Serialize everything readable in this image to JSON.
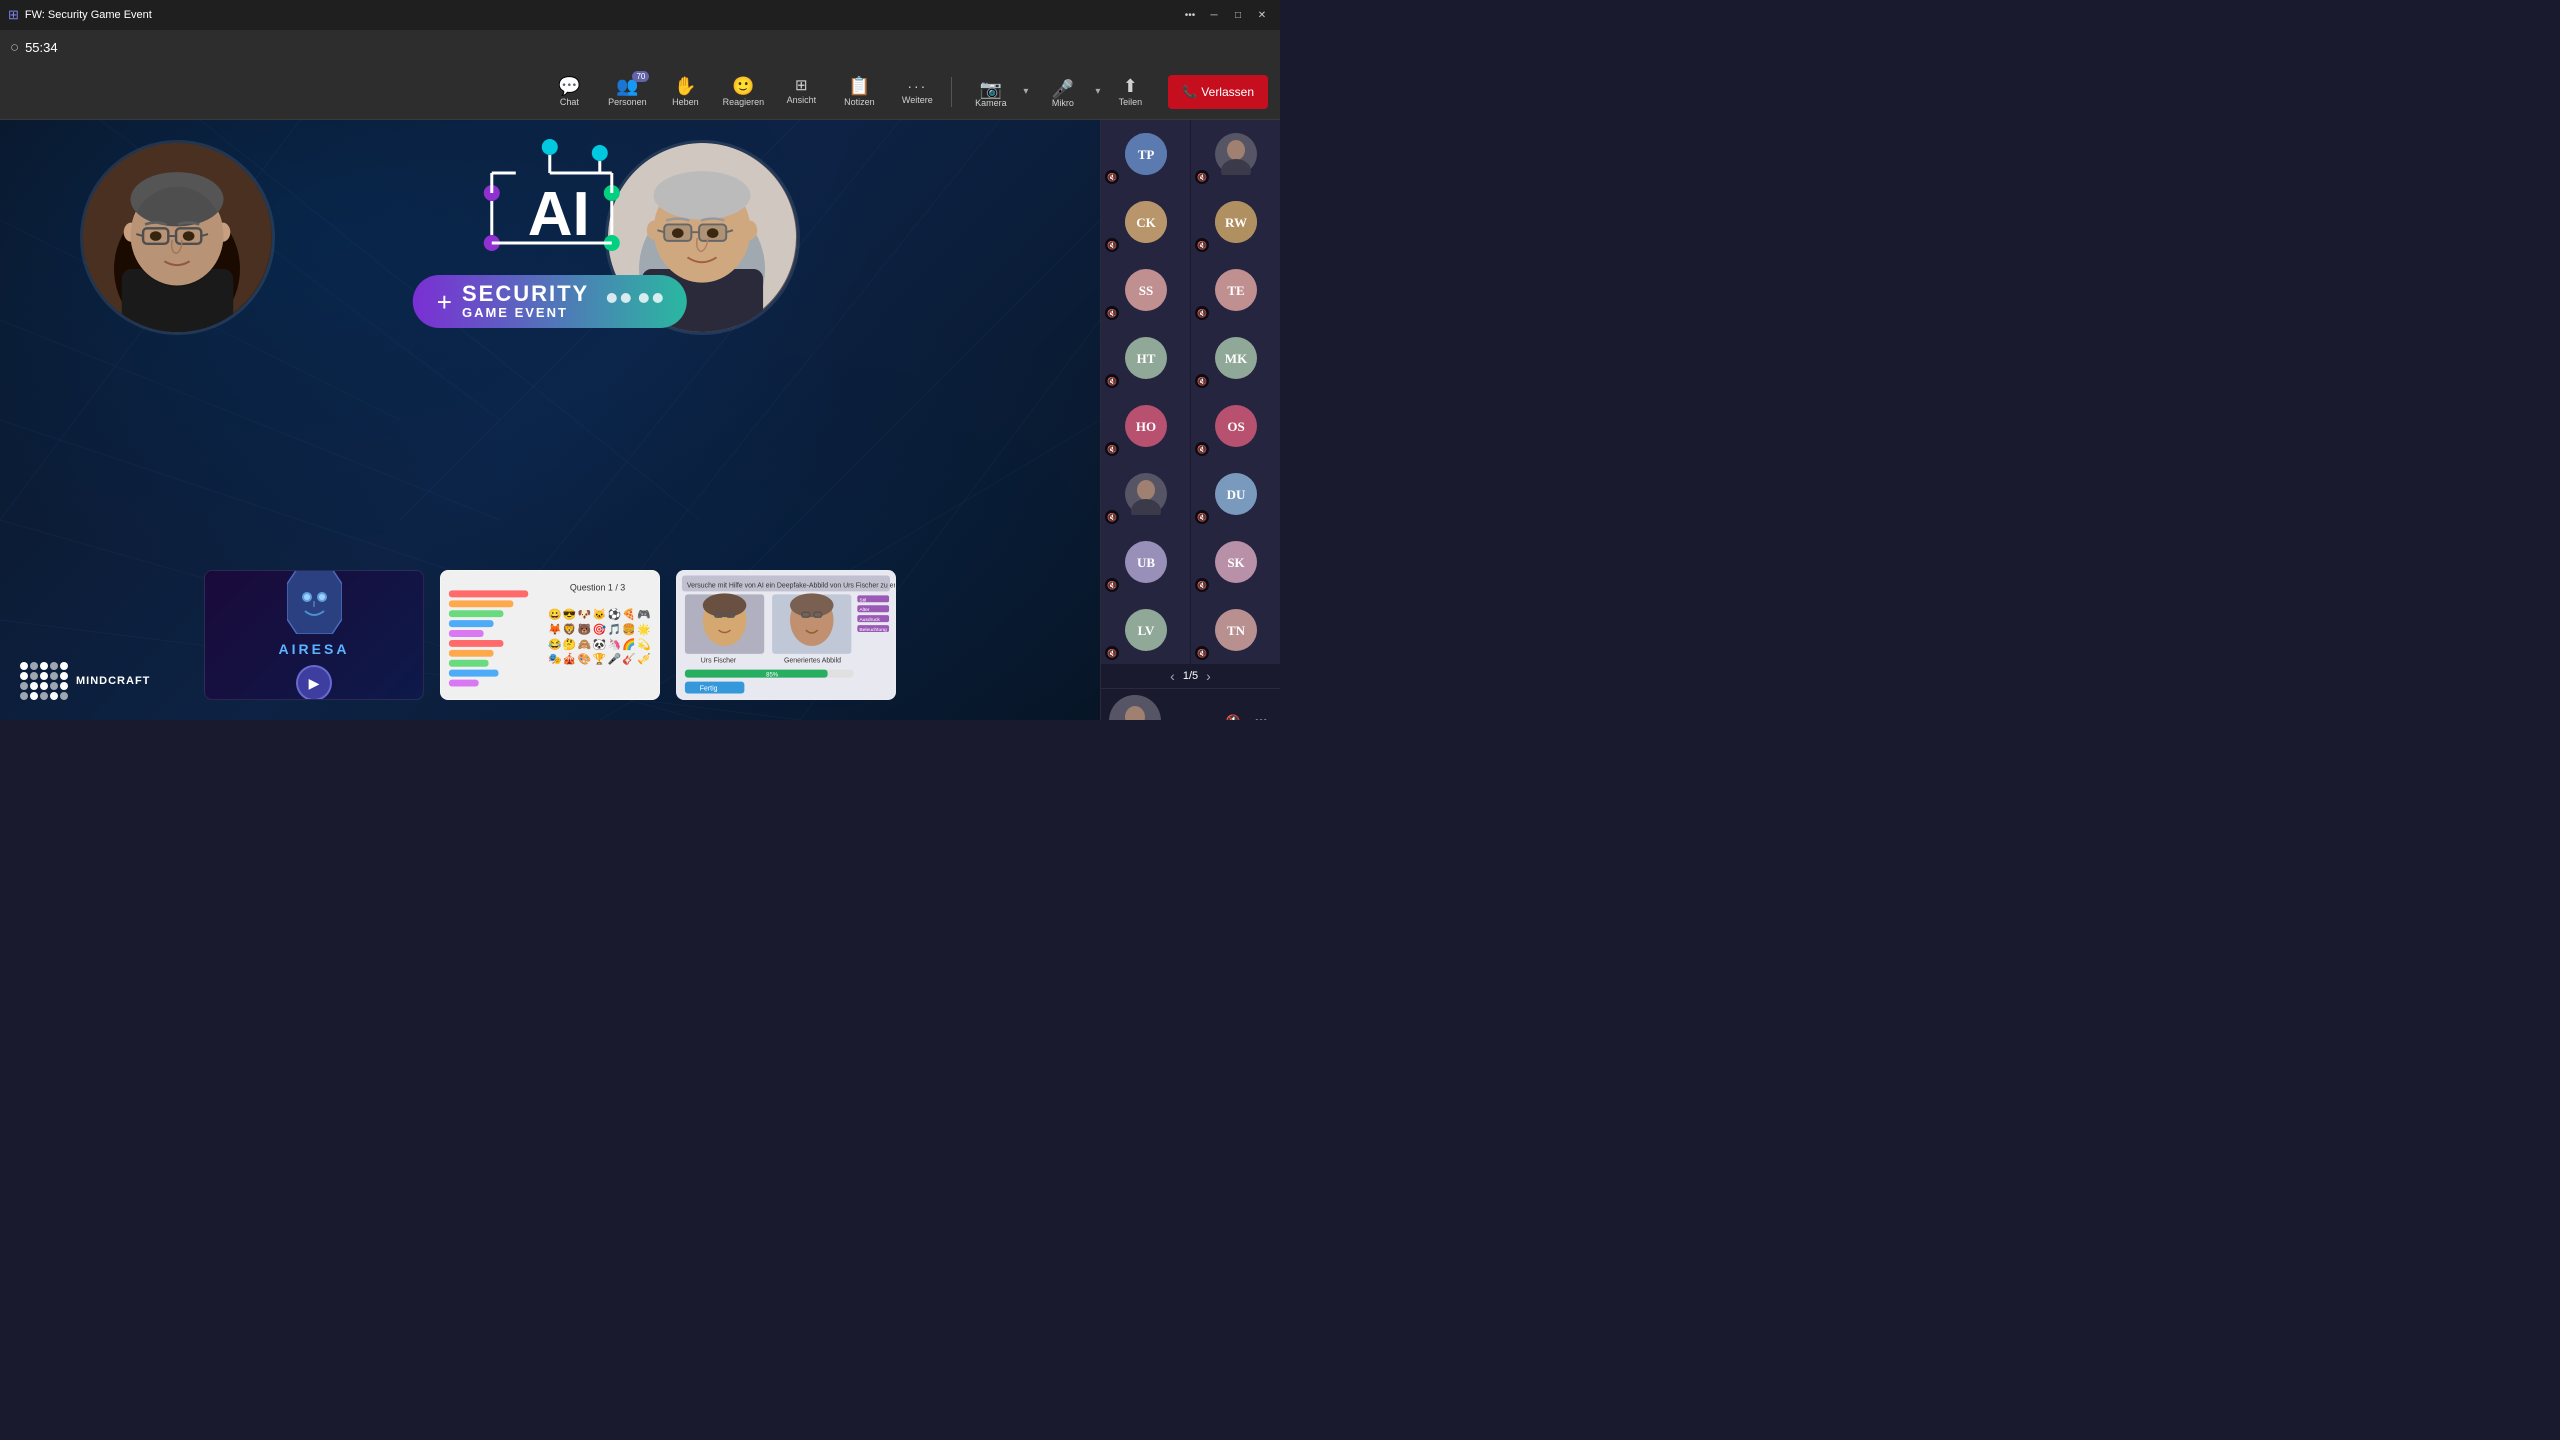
{
  "titlebar": {
    "title": "FW: Security Game Event",
    "icon": "⊕",
    "buttons": [
      "─",
      "□",
      "✕"
    ]
  },
  "timer": {
    "value": "55:34",
    "icon": "○"
  },
  "toolbar": {
    "items": [
      {
        "id": "chat",
        "icon": "💬",
        "label": "Chat"
      },
      {
        "id": "personen",
        "icon": "👥",
        "label": "Personen",
        "badge": "70"
      },
      {
        "id": "heben",
        "icon": "✋",
        "label": "Heben"
      },
      {
        "id": "reagieren",
        "icon": "😊",
        "label": "Reagieren"
      },
      {
        "id": "ansicht",
        "icon": "⊞",
        "label": "Ansicht"
      },
      {
        "id": "notizen",
        "icon": "📋",
        "label": "Notizen"
      },
      {
        "id": "weitere",
        "icon": "•••",
        "label": "Weitere"
      },
      {
        "id": "kamera",
        "icon": "📷",
        "label": "Kamera"
      },
      {
        "id": "mikro",
        "icon": "🎤",
        "label": "Mikro"
      },
      {
        "id": "teilen",
        "icon": "↑",
        "label": "Teilen"
      }
    ],
    "leave_label": "Verlassen"
  },
  "ai_logo": {
    "badge_plus": "+",
    "title": "SECURITY",
    "subtitle": "GAME EVENT"
  },
  "preview_cards": [
    {
      "id": "airesa",
      "type": "airesa",
      "label": "AIRESA"
    },
    {
      "id": "quiz",
      "type": "quiz",
      "label": "Question 1/3"
    },
    {
      "id": "deepfake",
      "type": "deepfake",
      "label": "Deepfake"
    }
  ],
  "mindcraft": {
    "name": "MINDCRAFT"
  },
  "participants": [
    {
      "id": "tp",
      "initials": "TP",
      "color": "#6a8fbd",
      "muted": true,
      "has_photo": true
    },
    {
      "id": "p2",
      "initials": "",
      "color": "#556",
      "muted": true,
      "has_photo": true
    },
    {
      "id": "ck",
      "initials": "CK",
      "color": "#d4b896",
      "muted": true,
      "has_photo": false
    },
    {
      "id": "rw",
      "initials": "RW",
      "color": "#d4b896",
      "muted": true,
      "has_photo": false
    },
    {
      "id": "ss",
      "initials": "SS",
      "color": "#c4a0a0",
      "muted": true,
      "has_photo": false
    },
    {
      "id": "te",
      "initials": "TE",
      "color": "#c4a0a0",
      "muted": true,
      "has_photo": false
    },
    {
      "id": "ht",
      "initials": "HT",
      "color": "#9ab4a4",
      "muted": true,
      "has_photo": false
    },
    {
      "id": "mk",
      "initials": "MK",
      "color": "#9ab4a4",
      "muted": true,
      "has_photo": false
    },
    {
      "id": "ho",
      "initials": "HO",
      "color": "#c87090",
      "muted": true,
      "has_photo": false
    },
    {
      "id": "os",
      "initials": "OS",
      "color": "#c87090",
      "muted": true,
      "has_photo": false
    },
    {
      "id": "du_photo",
      "initials": "",
      "color": "#556",
      "muted": true,
      "has_photo": true
    },
    {
      "id": "du",
      "initials": "DU",
      "color": "#7a9abd",
      "muted": true,
      "has_photo": false
    },
    {
      "id": "ub",
      "initials": "UB",
      "color": "#aaa0c0",
      "muted": true,
      "has_photo": false
    },
    {
      "id": "sk",
      "initials": "SK",
      "color": "#c4a0b4",
      "muted": true,
      "has_photo": false
    },
    {
      "id": "lv",
      "initials": "LV",
      "color": "#9ab4a4",
      "muted": true,
      "has_photo": false
    },
    {
      "id": "tn",
      "initials": "TN",
      "color": "#c4a0a0",
      "muted": true,
      "has_photo": false
    }
  ],
  "pagination": {
    "current": 1,
    "total": 5,
    "label": "1/5"
  },
  "bottom_participant": {
    "has_photo": true
  },
  "avatar_colors": {
    "ck": "#b8956a",
    "rw": "#b8956a",
    "ss": "#c09090",
    "te": "#c09090",
    "ht": "#90a898",
    "mk": "#90a898",
    "ho": "#b85070",
    "os": "#b85070",
    "ub": "#9890b8",
    "sk": "#b890a8",
    "lv": "#90a898",
    "tn": "#b89090"
  }
}
